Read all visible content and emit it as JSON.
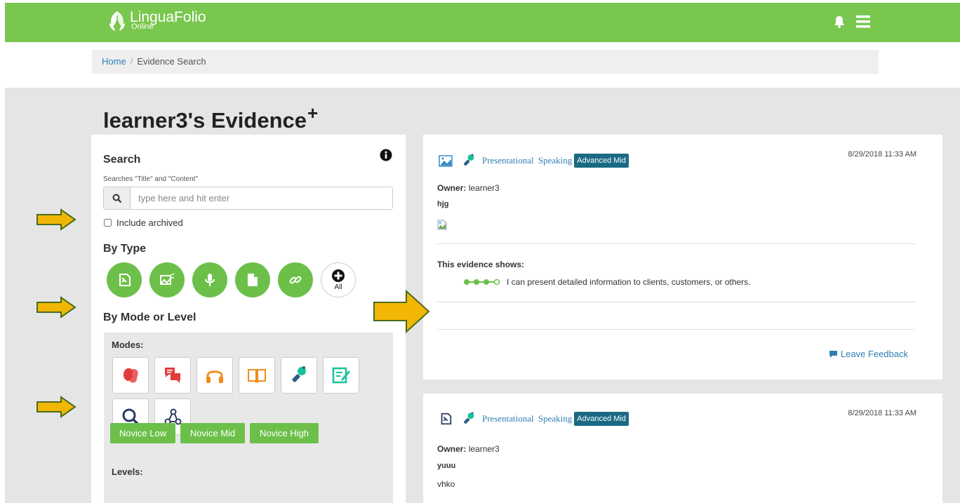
{
  "header": {
    "logo_main": "LinguaFolio",
    "logo_sub": "Online",
    "icons": [
      "leaf-logo-icon",
      "bell-icon",
      "hamburger-menu-icon"
    ]
  },
  "breadcrumb": {
    "home": "Home",
    "separator": "/",
    "current": "Evidence Search"
  },
  "page": {
    "title": "learner3's Evidence",
    "title_plus": "+"
  },
  "search": {
    "heading": "Search",
    "hint": "Searches \"Title\" and \"Content\"",
    "placeholder": "type here and hit enter",
    "value": "",
    "include_archived_label": "Include archived",
    "include_archived_checked": false
  },
  "by_type": {
    "heading": "By Type",
    "buttons": [
      "text-icon",
      "image-icon",
      "audio-icon",
      "file-icon",
      "link-icon"
    ],
    "all_label": "All"
  },
  "by_mode": {
    "heading": "By Mode or Level",
    "modes_label": "Modes:",
    "modes": [
      "interpersonal-speaking-icon",
      "interpersonal-writing-icon",
      "interpretive-listening-icon",
      "interpretive-reading-icon",
      "presentational-speaking-icon",
      "presentational-writing-icon",
      "interpretive-viewing-icon",
      "intercultural-icon"
    ],
    "levels_label": "Levels:",
    "levels": [
      "Novice Low",
      "Novice Mid",
      "Novice High"
    ]
  },
  "evidence": [
    {
      "mode": "Presentational Speaking",
      "level": "Advanced Mid",
      "date": "8/29/2018 11:33 AM",
      "owner_label": "Owner:",
      "owner": "learner3",
      "title": "hjg",
      "shows_label": "This evidence shows:",
      "can_do": "I can present detailed information to clients, customers, or others.",
      "feedback": "Leave Feedback"
    },
    {
      "mode": "Presentational Speaking",
      "level": "Advanced Mid",
      "date": "8/29/2018 11:33 AM",
      "owner_label": "Owner:",
      "owner": "learner3",
      "title": "yuuu",
      "body": "vhko"
    }
  ],
  "colors": {
    "green": "#7ac74f",
    "type_green": "#6cc04a",
    "badge": "#1a6a84",
    "link": "#2f7fb5",
    "arrow": "#f2b705",
    "arrow_stroke": "#4a6b1d"
  }
}
